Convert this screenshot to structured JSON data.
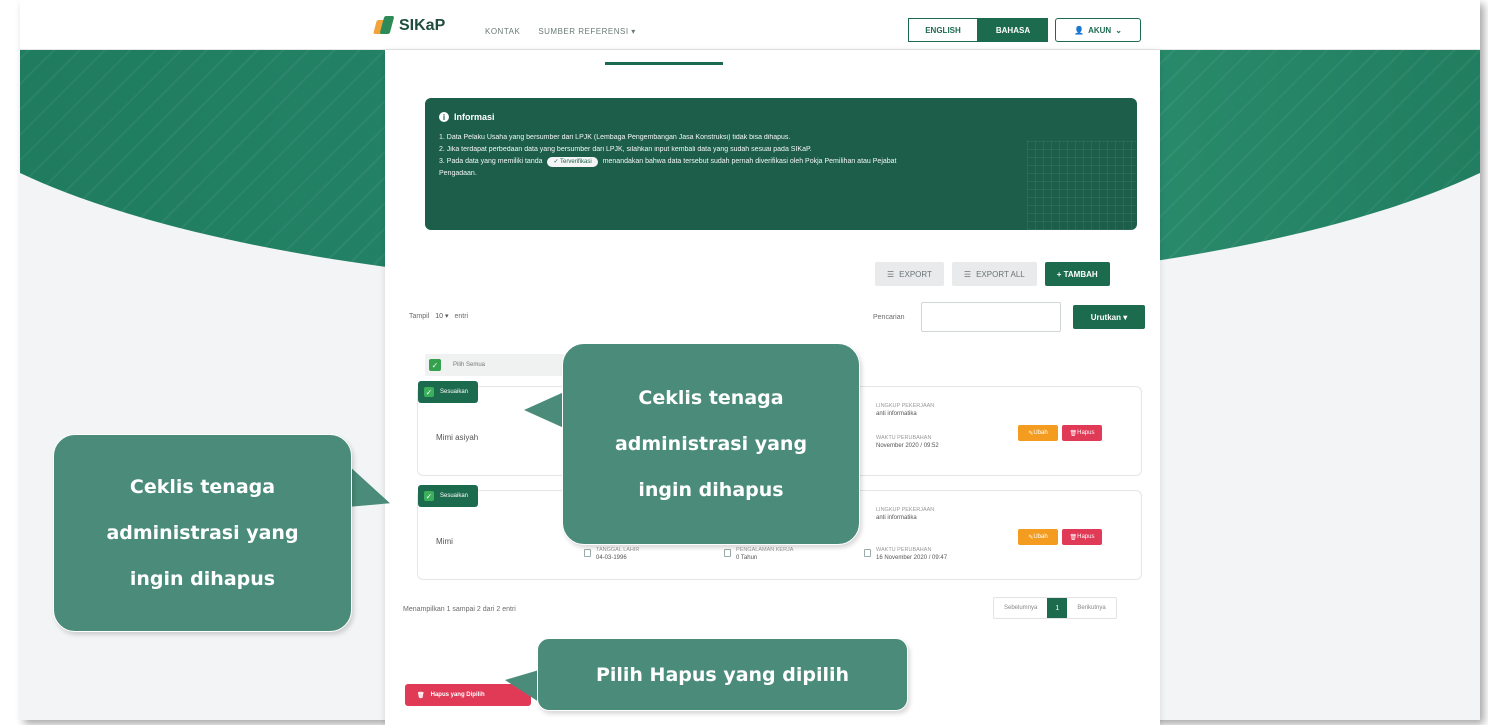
{
  "header": {
    "logo_text": "SIKaP",
    "nav": [
      "KONTAK",
      "SUMBER REFERENSI ▾"
    ],
    "lang_en": "ENGLISH",
    "lang_id": "BAHASA",
    "akun_label": "AKUN"
  },
  "info": {
    "title": "Informasi",
    "line1": "1. Data Pelaku Usaha yang bersumber dari LPJK (Lembaga Pengembangan Jasa Konstruksi) tidak bisa dihapus.",
    "line2": "2. Jika terdapat perbedaan data yang bersumber dari LPJK, silahkan input kembali data yang sudah sesuai pada SIKaP.",
    "line3_a": "3. Pada data yang memiliki tanda",
    "verified": "✓ Terverifikasi",
    "line3_b": "menandakan bahwa data tersebut sudah pernah diverifikasi oleh Pokja Pemilihan atau Pejabat",
    "line4": "Pengadaan."
  },
  "toolbar": {
    "export": "EXPORT",
    "export_all": "EXPORT ALL",
    "tambah": "+ TAMBAH"
  },
  "filter": {
    "show_prefix": "Tampil",
    "show_value": "10",
    "show_suffix": "entri",
    "search_label": "Pencarian",
    "sort_label": "Urutkan ▾"
  },
  "select_all_label": "Pilih Semua",
  "cards": [
    {
      "check_label": "Sesuaikan",
      "name": "Mimi asiyah",
      "f3_label": "LINGKUP PEKERJAAN",
      "f3_value": "anti informatika",
      "f4_label": "WAKTU PERUBAHAN",
      "f4_value": "November 2020 / 09:52"
    },
    {
      "check_label": "Sesuaikan",
      "name": "Mimi",
      "f1_label": "TANGGAL LAHIR",
      "f1_value": "04-03-1996",
      "f2_label": "PENGALAMAN KERJA",
      "f2_value": "0 Tahun",
      "f3_label": "LINGKUP PEKERJAAN",
      "f3_value": "anti informatika",
      "f4_label": "WAKTU PERUBAHAN",
      "f4_value": "16 November 2020 / 09:47"
    }
  ],
  "card_actions": {
    "ubah": "Ubah",
    "hapus": "Hapus"
  },
  "footer": {
    "summary": "Menampilkan 1 sampai 2 dari 2 entri",
    "prev": "Sebelumnya",
    "page": "1",
    "next": "Berikutnya"
  },
  "hapus_terpilih": "Hapus yang Dipilih",
  "callouts": {
    "top": [
      "Ceklis tenaga",
      "administrasi yang",
      "ingin dihapus"
    ],
    "left": [
      "Ceklis tenaga",
      "administrasi yang",
      "ingin dihapus"
    ],
    "bottom": "Pilih Hapus yang dipilih"
  },
  "colors": {
    "primary": "#1d6b4f",
    "danger": "#e03a56",
    "warning": "#f39c1f",
    "callout": "#4a8c79"
  }
}
